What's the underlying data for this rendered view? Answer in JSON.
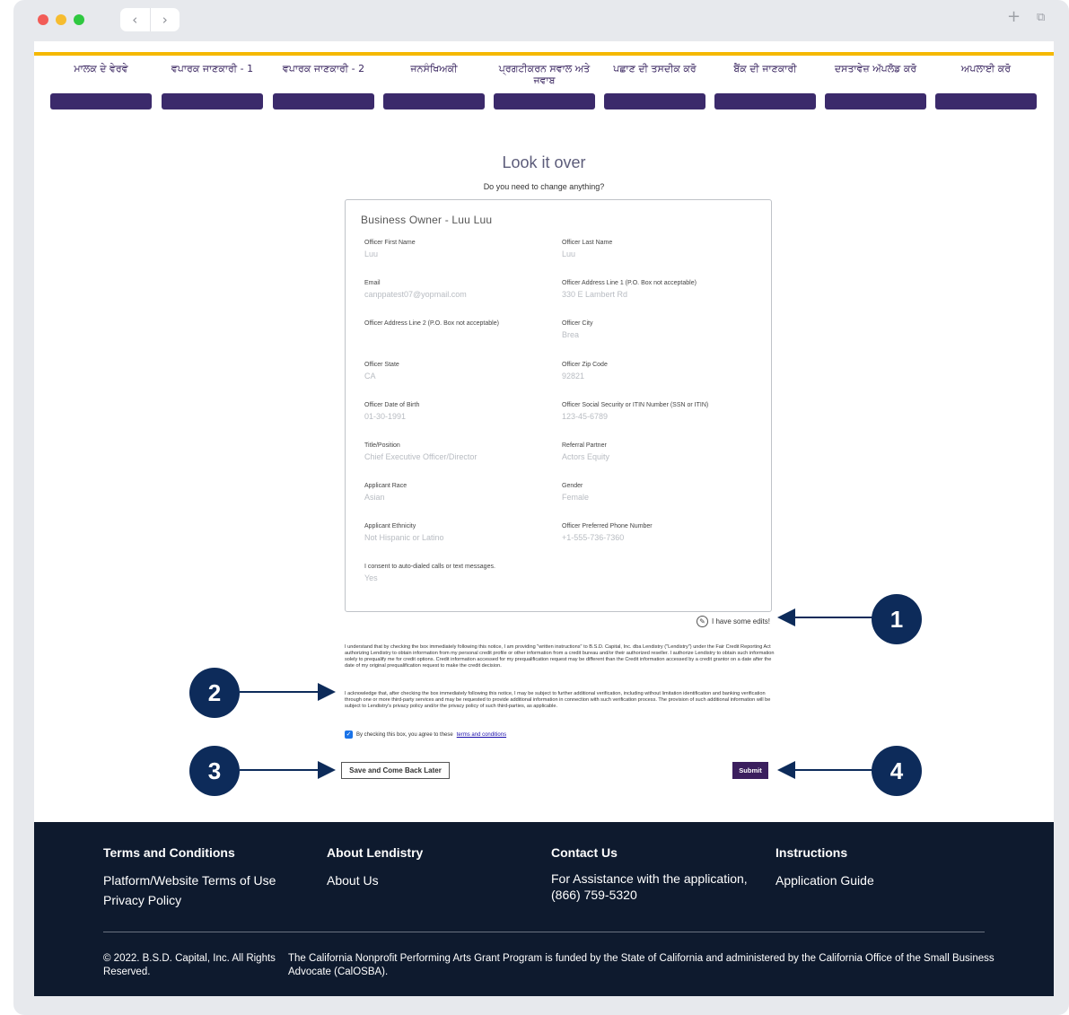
{
  "steps": [
    {
      "label": "ਮਾਲਕ ਦੇ ਵੇਰਵੇ"
    },
    {
      "label": "ਵਪਾਰਕ ਜਾਣਕਾਰੀ - 1"
    },
    {
      "label": "ਵਪਾਰਕ ਜਾਣਕਾਰੀ - 2"
    },
    {
      "label": "ਜਨਸੰਖਿਅਕੀ"
    },
    {
      "label": "ਪ੍ਰਗਟੀਕਰਨ ਸਵਾਲ ਅਤੇ ਜਵਾਬ"
    },
    {
      "label": "ਪਛਾਣ ਦੀ ਤਸਦੀਕ ਕਰੋ"
    },
    {
      "label": "ਬੈਂਕ ਦੀ ਜਾਣਕਾਰੀ"
    },
    {
      "label": "ਦਸਤਾਵੇਜ਼ ਅੱਪਲੋਡ ਕਰੋ"
    },
    {
      "label": "ਅਪਲਾਈ ਕਰੋ"
    }
  ],
  "page": {
    "title": "Look it over",
    "subtitle": "Do you need to change anything?"
  },
  "card": {
    "title": "Business Owner - Luu Luu",
    "fields": [
      {
        "label": "Officer First Name",
        "value": "Luu"
      },
      {
        "label": "Officer Last Name",
        "value": "Luu"
      },
      {
        "label": "Email",
        "value": "canppatest07@yopmail.com"
      },
      {
        "label": "Officer Address Line 1 (P.O. Box not acceptable)",
        "value": "330 E Lambert Rd"
      },
      {
        "label": "Officer Address Line 2 (P.O. Box not acceptable)",
        "value": ""
      },
      {
        "label": "Officer City",
        "value": "Brea"
      },
      {
        "label": "Officer State",
        "value": "CA"
      },
      {
        "label": "Officer Zip Code",
        "value": "92821"
      },
      {
        "label": "Officer Date of Birth",
        "value": "01-30-1991"
      },
      {
        "label": "Officer Social Security or ITIN Number (SSN or ITIN)",
        "value": "123-45-6789"
      },
      {
        "label": "Title/Position",
        "value": "Chief Executive Officer/Director"
      },
      {
        "label": "Referral Partner",
        "value": "Actors Equity"
      },
      {
        "label": "Applicant Race",
        "value": "Asian"
      },
      {
        "label": "Gender",
        "value": "Female"
      },
      {
        "label": "Applicant Ethnicity",
        "value": "Not Hispanic or Latino"
      },
      {
        "label": "Officer Preferred Phone Number",
        "value": "+1-555-736-7360"
      },
      {
        "label": "I consent to auto-dialed calls or text messages.",
        "value": "Yes"
      }
    ]
  },
  "edits_label": "I have some edits!",
  "consent": {
    "para1": "I understand that by checking the box immediately following this notice, I am providing \"written instructions\" to B.S.D. Capital, Inc. dba Lendistry (\"Lendistry\") under the Fair Credit Reporting Act authorizing Lendistry to obtain information from my personal credit profile or other information from a credit bureau and/or their authorized reseller. I authorize Lendistry to obtain such information solely to prequalify me for credit options. Credit information accessed for my prequalification request may be different than the Credit information accessed by a credit grantor on a date after the date of my original prequalification request to make the credit decision.",
    "para2": "I acknowledge that, after checking the box immediately following this notice, I may be subject to further additional verification, including without limitation identification and banking verification through one or more third-party services and may be requested to provide additional information in connection with such verification process. The provision of such additional information will be subject to Lendistry's privacy policy and/or the privacy policy of such third-parties, as applicable.",
    "checkbox_text": "By checking this box, you agree to these",
    "terms_link": "terms and conditions"
  },
  "buttons": {
    "save": "Save and Come Back Later",
    "submit": "Submit"
  },
  "footer": {
    "col1": {
      "heading": "Terms and Conditions",
      "links": [
        "Platform/Website Terms of Use",
        "Privacy Policy"
      ]
    },
    "col2": {
      "heading": "About Lendistry",
      "links": [
        "About Us"
      ]
    },
    "col3": {
      "heading": "Contact Us",
      "text": "For Assistance with the application, (866) 759-5320"
    },
    "col4": {
      "heading": "Instructions",
      "links": [
        "Application Guide"
      ]
    },
    "copyright": "© 2022. B.S.D. Capital, Inc. All Rights Reserved.",
    "note": "The California Nonprofit Performing Arts Grant Program is funded by the State of California and administered by the California Office of the Small Business Advocate (CalOSBA)."
  },
  "callouts": [
    "1",
    "2",
    "3",
    "4"
  ],
  "colors": {
    "accent_purple": "#3b2a6b",
    "gold": "#f5b800",
    "footer_bg": "#0e1a2e",
    "callout_bg": "#0d2b5a"
  }
}
